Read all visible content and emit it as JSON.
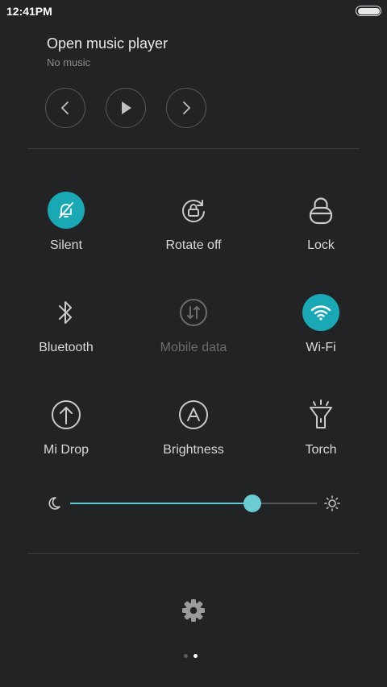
{
  "status_bar": {
    "time": "12:41PM",
    "battery_icon": "battery-icon"
  },
  "music": {
    "title": "Open music player",
    "subtitle": "No music",
    "controls": [
      "previous-icon",
      "play-icon",
      "next-icon"
    ]
  },
  "tiles": [
    {
      "label": "Silent",
      "icon": "bell-off-icon",
      "active": true
    },
    {
      "label": "Rotate off",
      "icon": "rotate-lock-icon",
      "active": false
    },
    {
      "label": "Lock",
      "icon": "lock-icon",
      "active": false
    },
    {
      "label": "Bluetooth",
      "icon": "bluetooth-icon",
      "active": false
    },
    {
      "label": "Mobile data",
      "icon": "mobile-data-icon",
      "active": false,
      "disabled": true
    },
    {
      "label": "Wi-Fi",
      "icon": "wifi-icon",
      "active": true
    },
    {
      "label": "Mi Drop",
      "icon": "upload-icon",
      "active": false
    },
    {
      "label": "Brightness",
      "icon": "auto-brightness-icon",
      "active": false
    },
    {
      "label": "Torch",
      "icon": "torch-icon",
      "active": false
    }
  ],
  "brightness": {
    "level": 0.74
  },
  "colors": {
    "accent": "#1aa8b4",
    "background": "#222325"
  },
  "pager": {
    "count": 2,
    "active_index": 1
  }
}
